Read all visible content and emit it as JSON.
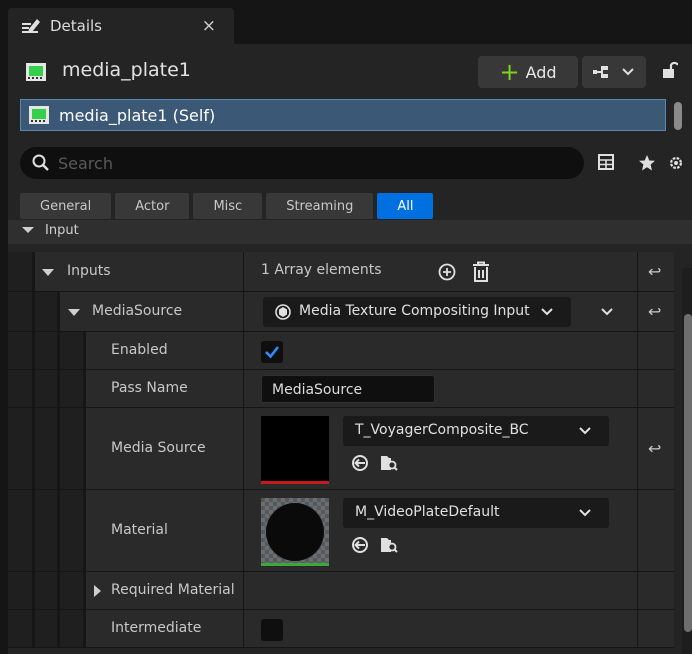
{
  "tab": {
    "title": "Details",
    "close": "×"
  },
  "actor": {
    "name": "media_plate1"
  },
  "toolbar": {
    "add_label": "Add",
    "add_symbol": "+"
  },
  "component": {
    "label": "media_plate1 (Self)"
  },
  "search": {
    "placeholder": "Search"
  },
  "filters": [
    {
      "label": "General",
      "active": false
    },
    {
      "label": "Actor",
      "active": false
    },
    {
      "label": "Misc",
      "active": false
    },
    {
      "label": "Streaming",
      "active": false
    },
    {
      "label": "All",
      "active": true
    }
  ],
  "category": {
    "label": "Input"
  },
  "properties": {
    "inputs": {
      "label": "Inputs",
      "value": "1 Array elements"
    },
    "media_source_elem": {
      "label": "MediaSource",
      "value": "Media Texture Compositing Input"
    },
    "enabled": {
      "label": "Enabled",
      "checked": true
    },
    "pass_name": {
      "label": "Pass Name",
      "value": "MediaSource"
    },
    "media_source": {
      "label": "Media Source",
      "asset": "T_VoyagerComposite_BC",
      "bar_color": "#c41a1a"
    },
    "material": {
      "label": "Material",
      "asset": "M_VideoPlateDefault",
      "bar_color": "#3aa83a"
    },
    "required_material": {
      "label": "Required Material"
    },
    "intermediate": {
      "label": "Intermediate",
      "checked": false
    }
  },
  "colors": {
    "accent": "#0070e0",
    "selection": "#3b5877",
    "add_plus": "#7ed321"
  }
}
